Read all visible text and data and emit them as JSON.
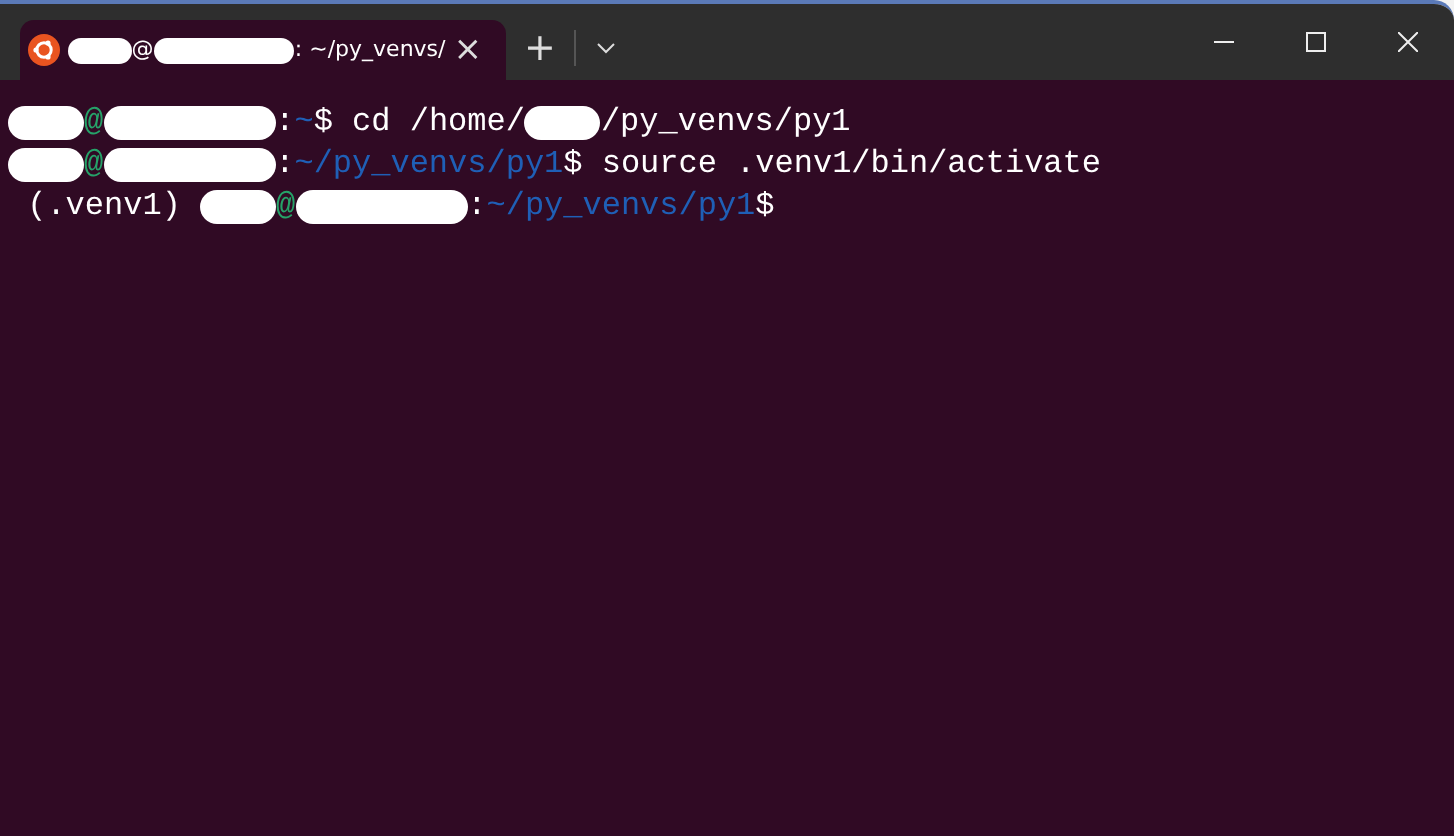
{
  "tab": {
    "title": [
      {
        "kind": "hidden"
      },
      {
        "kind": "plain",
        "text": "@"
      },
      {
        "kind": "hidden_wide"
      },
      {
        "kind": "plain",
        "text": ": ~/py_venvs/"
      }
    ],
    "selected": true,
    "close": "×"
  },
  "new_tab": "+",
  "terminal": {
    "lines": [
      [
        {
          "kind": "hidden"
        },
        {
          "kind": "user",
          "text": "@"
        },
        {
          "kind": "hidden_wide"
        },
        {
          "kind": "plain",
          "text": ":"
        },
        {
          "kind": "path",
          "text": "~"
        },
        {
          "kind": "plain",
          "text": "$ cd /home/"
        },
        {
          "kind": "hidden"
        },
        {
          "kind": "plain",
          "text": "/py_venvs/py1"
        }
      ],
      [
        {
          "kind": "hidden"
        },
        {
          "kind": "user",
          "text": "@"
        },
        {
          "kind": "hidden_wide"
        },
        {
          "kind": "plain",
          "text": ":"
        },
        {
          "kind": "path",
          "text": "~/py_venvs/py1"
        },
        {
          "kind": "plain",
          "text": "$ source .venv1/bin/activate"
        }
      ],
      [
        {
          "kind": "plain",
          "text": " (.venv1) "
        },
        {
          "kind": "hidden"
        },
        {
          "kind": "user",
          "text": "@"
        },
        {
          "kind": "hidden_wide"
        },
        {
          "kind": "plain",
          "text": ":"
        },
        {
          "kind": "path",
          "text": "~/py_venvs/py1"
        },
        {
          "kind": "plain",
          "text": "$"
        }
      ]
    ]
  }
}
